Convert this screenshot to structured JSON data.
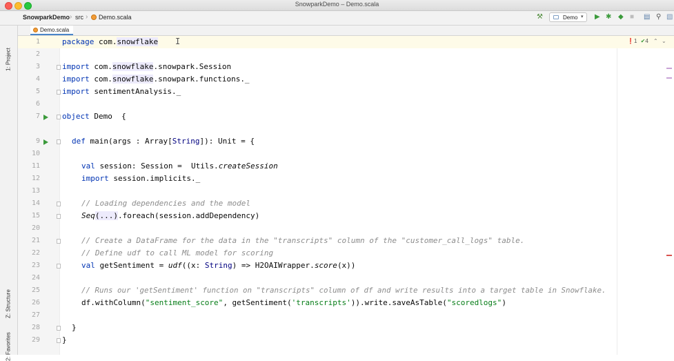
{
  "window": {
    "title": "SnowparkDemo – Demo.scala"
  },
  "breadcrumb": {
    "project": "SnowparkDemo",
    "folder": "src",
    "file": "Demo.scala"
  },
  "toolbar": {
    "run_config": "Demo",
    "run_config_arrow": "▾"
  },
  "icons": {
    "run_config": "run-configuration-icon",
    "build": "hammer-icon",
    "run": "run-icon",
    "debug": "debug-icon",
    "coverage": "coverage-icon",
    "stop": "stop-icon",
    "layout": "layout-icon",
    "search": "search-icon",
    "folder": "folder-icon"
  },
  "tool_windows": {
    "project": "1: Project",
    "structure": "Z: Structure",
    "favorites": "2: Favorites"
  },
  "tab": {
    "label": "Demo.scala"
  },
  "inspections": {
    "errors": "1",
    "warnings": "4"
  },
  "editor": {
    "line_numbers": [
      "1",
      "2",
      "3",
      "4",
      "5",
      "6",
      "7",
      "9",
      "10",
      "11",
      "12",
      "13",
      "14",
      "15",
      "20",
      "21",
      "22",
      "23",
      "24",
      "25",
      "26",
      "27",
      "28",
      "29"
    ],
    "run_markers": [
      "7",
      "9"
    ],
    "lines": {
      "l1": {
        "kw": "package",
        "a": " com.",
        "hl": "snowflake"
      },
      "l3": {
        "kw": "import",
        "a": " com.",
        "hl": "snowflake",
        "b": ".snowpark.Session"
      },
      "l4": {
        "kw": "import",
        "a": " com.",
        "hl": "snowflake",
        "b": ".snowpark.functions._"
      },
      "l5": {
        "kw": "import",
        "a": " sentimentAnalysis._"
      },
      "l7": {
        "kw": "object",
        "a": " Demo  {"
      },
      "l9": {
        "kw": "def",
        "a": " main(args : Array[",
        "ty": "String",
        "b": "]): Unit = {"
      },
      "l11": {
        "kw": "val",
        "a": " session: Session =  Utils.",
        "it": "createSession"
      },
      "l12": {
        "kw": "import",
        "a": " session.implicits._"
      },
      "l14": "// Loading dependencies and the model",
      "l15": {
        "it": "Seq",
        "hl": "(...)",
        "a": ".foreach(session.addDependency)"
      },
      "l21": "// Create a DataFrame for the data in the \"transcripts\" column of the \"customer_call_logs\" table.",
      "l22": "// Define udf to call ML model for scoring",
      "l23": {
        "kw": "val",
        "a": " getSentiment = ",
        "it": "udf",
        "b": "((x: ",
        "ty": "String",
        "c": ") => H2OAIWrapper.",
        "it2": "score",
        "d": "(x))"
      },
      "l25": "// Runs our 'getSentiment' function on \"transcripts\" column of df and write results into a target table in Snowflake.",
      "l26": {
        "a": "df.withColumn(",
        "s1": "\"sentiment_score\"",
        "b": ", getSentiment(",
        "s2": "'transcripts'",
        "c": ")).write.saveAsTable(",
        "s3": "\"scoredlogs\"",
        "d": ")"
      },
      "l28": "}",
      "l29": "}"
    }
  },
  "colors": {
    "keyword": "#0033b3",
    "comment": "#8c8c8c",
    "string": "#067d17",
    "run_green": "#3b9a3b",
    "error_red": "#d9534f",
    "current_line": "#fefbe8"
  }
}
